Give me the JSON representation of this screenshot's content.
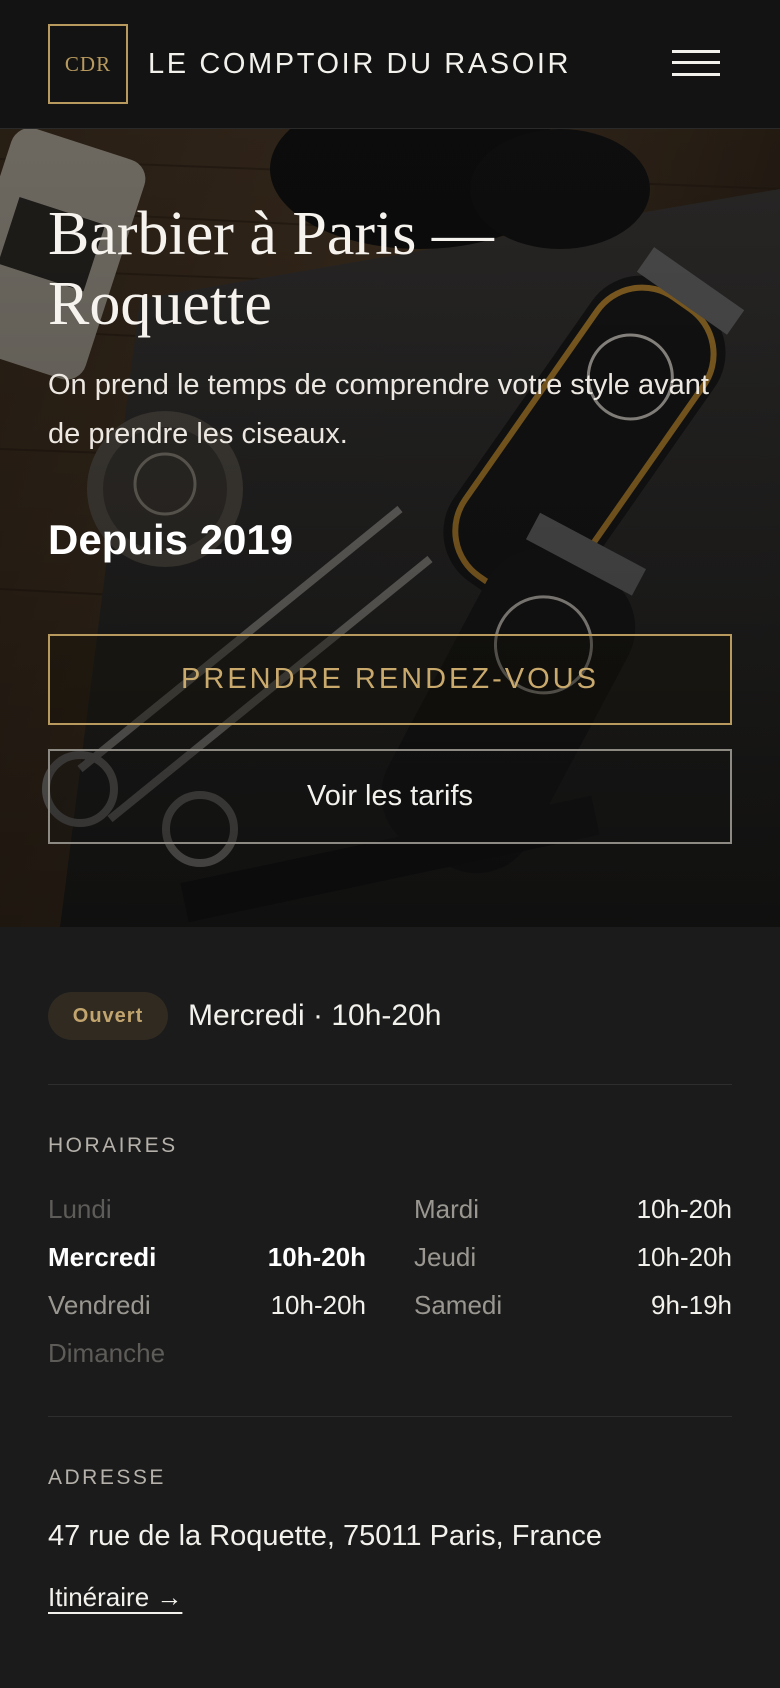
{
  "header": {
    "logo_text": "CDR",
    "brand_name": "LE COMPTOIR DU RASOIR",
    "menu_icon": "hamburger-menu-icon"
  },
  "hero": {
    "background": "barber-tools-photo",
    "title": "Barbier à Paris — Roquette",
    "subtitle": "On prend le temps de comprendre votre style avant de prendre les ciseaux.",
    "since": "Depuis 2019",
    "primary_button": "PRENDRE RENDEZ-VOUS",
    "secondary_button": "Voir les tarifs"
  },
  "status": {
    "badge": "Ouvert",
    "text": "Mercredi · 10h-20h"
  },
  "hours": {
    "label": "HORAIRES",
    "left": [
      {
        "day": "Lundi",
        "time": "",
        "state": "closed"
      },
      {
        "day": "Mercredi",
        "time": "10h-20h",
        "state": "today"
      },
      {
        "day": "Vendredi",
        "time": "10h-20h",
        "state": "open"
      },
      {
        "day": "Dimanche",
        "time": "",
        "state": "closed"
      }
    ],
    "right": [
      {
        "day": "Mardi",
        "time": "10h-20h",
        "state": "open"
      },
      {
        "day": "Jeudi",
        "time": "10h-20h",
        "state": "open"
      },
      {
        "day": "Samedi",
        "time": "9h-19h",
        "state": "open"
      }
    ]
  },
  "address": {
    "label": "ADRESSE",
    "text": "47 rue de la Roquette, 75011 Paris, France",
    "link": "Itinéraire →"
  },
  "colors": {
    "accent_gold": "#b89a5f",
    "header_bg": "#131313",
    "page_bg": "#1b1b1b",
    "badge_bg": "#302a21"
  }
}
